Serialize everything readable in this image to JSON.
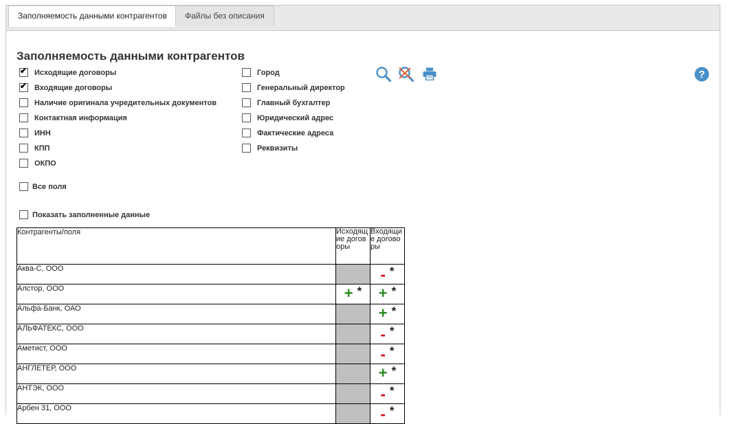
{
  "tabs": [
    {
      "label": "Заполняемость данными контрагентов",
      "active": true
    },
    {
      "label": "Файлы без описания",
      "active": false
    }
  ],
  "page_title": "Заполняемость данными контрагентов",
  "fields_left": [
    {
      "label": "Исходящие договоры",
      "checked": true
    },
    {
      "label": "Входящие договоры",
      "checked": true
    },
    {
      "label": "Наличие оригинала учредительных документов",
      "checked": false
    },
    {
      "label": "Контактная информация",
      "checked": false
    },
    {
      "label": "ИНН",
      "checked": false
    },
    {
      "label": "КПП",
      "checked": false
    },
    {
      "label": "ОКПО",
      "checked": false
    }
  ],
  "fields_right": [
    {
      "label": "Город",
      "checked": false
    },
    {
      "label": "Генеральный директор",
      "checked": false
    },
    {
      "label": "Главный бухгалтер",
      "checked": false
    },
    {
      "label": "Юридический адрес",
      "checked": false
    },
    {
      "label": "Фактические адреса",
      "checked": false
    },
    {
      "label": "Реквизиты",
      "checked": false
    }
  ],
  "all_fields": {
    "label": "Все поля",
    "checked": false
  },
  "show_filled": {
    "label": "Показать заполненные данные",
    "checked": false
  },
  "toolbar": {
    "icons": [
      "search-icon",
      "clear-search-icon",
      "print-icon"
    ],
    "help_icon": "help-icon",
    "accent": "#4a90c8"
  },
  "table": {
    "header": {
      "name": "Контрагенты/поля",
      "col1": "Исходящие договоры",
      "col2": "Входящие договоры"
    },
    "rows": [
      {
        "name": "Аква-С, ООО",
        "col1": "empty",
        "col2": "minus"
      },
      {
        "name": "Алстор, ООО",
        "col1": "plus",
        "col2": "plus"
      },
      {
        "name": "Альфа-Банк, ОАО",
        "col1": "empty",
        "col2": "plus"
      },
      {
        "name": "АЛЬФАТЕКС, ООО",
        "col1": "empty",
        "col2": "minus"
      },
      {
        "name": "Аметист, ООО",
        "col1": "empty",
        "col2": "minus"
      },
      {
        "name": "АНГЛЕТЕР, ООО",
        "col1": "empty",
        "col2": "plus"
      },
      {
        "name": "АНТЭК, ООО",
        "col1": "empty",
        "col2": "minus"
      },
      {
        "name": "Арбен 31, ООО",
        "col1": "empty",
        "col2": "minus"
      }
    ],
    "symbols": {
      "plus": "+",
      "minus": "-",
      "star": "*"
    },
    "colors": {
      "plus": "#2a8a1e",
      "minus": "#d00000",
      "empty_cell": "#c0c0c0"
    }
  }
}
